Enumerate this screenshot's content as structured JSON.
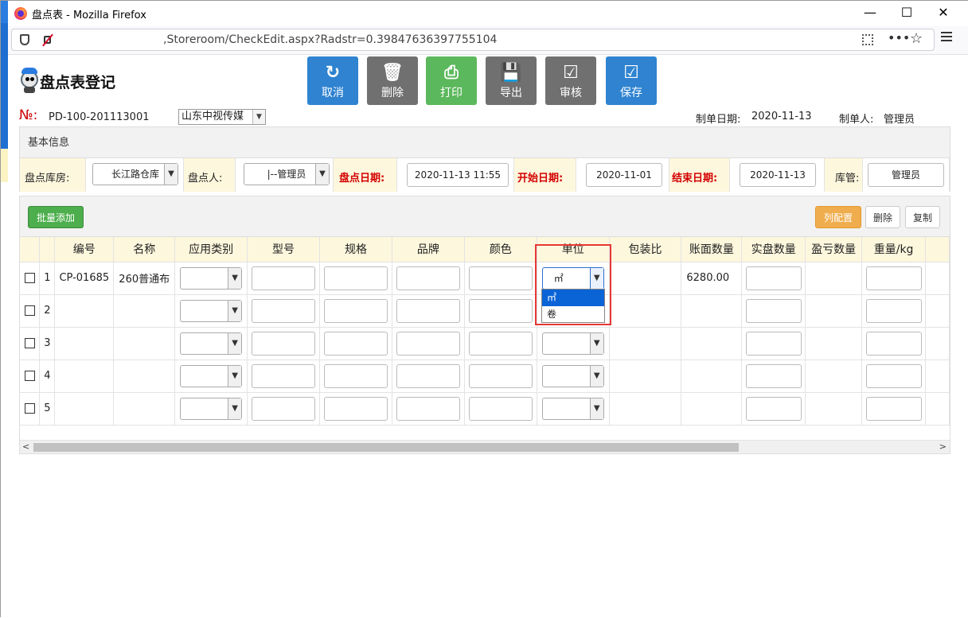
{
  "window": {
    "title": "盘点表 - Mozilla Firefox",
    "url": ",Storeroom/CheckEdit.aspx?Radstr=0.39847636397755104",
    "controls": {
      "minimize": "—",
      "maximize": "☐",
      "close": "✕"
    },
    "browser_icons": {
      "more": "•••",
      "bookmark": "☆"
    }
  },
  "header": {
    "title": "盘点表登记"
  },
  "toolbar": [
    {
      "label": "取消",
      "icon": "↻",
      "color": "#2f83d0"
    },
    {
      "label": "删除",
      "icon": "🗑",
      "color": "#707070"
    },
    {
      "label": "打印",
      "icon": "⎙",
      "color": "#5cb85c"
    },
    {
      "label": "导出",
      "icon": "💾",
      "color": "#707070"
    },
    {
      "label": "审核",
      "icon": "☑",
      "color": "#707070"
    },
    {
      "label": "保存",
      "icon": "☑",
      "color": "#2f83d0"
    }
  ],
  "doc": {
    "no_label": "№:",
    "no_value": "PD-100-201113001",
    "company": "山东中视传媒",
    "date_label": "制单日期:",
    "date_value": "2020-11-13",
    "maker_label": "制单人:",
    "maker_value": "管理员"
  },
  "basic": {
    "title": "基本信息",
    "warehouse_label": "盘点库房:",
    "warehouse_value": "长江路仓库",
    "checker_label": "盘点人:",
    "checker_value": "|--管理员",
    "check_date_label": "盘点日期:",
    "check_date_value": "2020-11-13 11:55",
    "start_label": "开始日期:",
    "start_value": "2020-11-01",
    "end_label": "结束日期:",
    "end_value": "2020-11-13",
    "keeper_label": "库管:",
    "keeper_value": "管理员"
  },
  "grid": {
    "batch_add": "批量添加",
    "col_config": "列配置",
    "delete": "删除",
    "copy": "复制",
    "columns": [
      "编号",
      "名称",
      "应用类别",
      "型号",
      "规格",
      "品牌",
      "颜色",
      "单位",
      "包装比",
      "账面数量",
      "实盘数量",
      "盈亏数量",
      "重量/kg"
    ],
    "rows": [
      {
        "index": "1",
        "code": "CP-01685",
        "name": "260普通布",
        "unit": "㎡",
        "book_qty": "6280.00"
      },
      {
        "index": "2",
        "code": "",
        "name": "",
        "unit": "",
        "book_qty": ""
      },
      {
        "index": "3",
        "code": "",
        "name": "",
        "unit": "",
        "book_qty": ""
      },
      {
        "index": "4",
        "code": "",
        "name": "",
        "unit": "",
        "book_qty": ""
      },
      {
        "index": "5",
        "code": "",
        "name": "",
        "unit": "",
        "book_qty": ""
      }
    ],
    "unit_options": [
      "㎡",
      "卷"
    ],
    "unit_selected": "㎡"
  }
}
